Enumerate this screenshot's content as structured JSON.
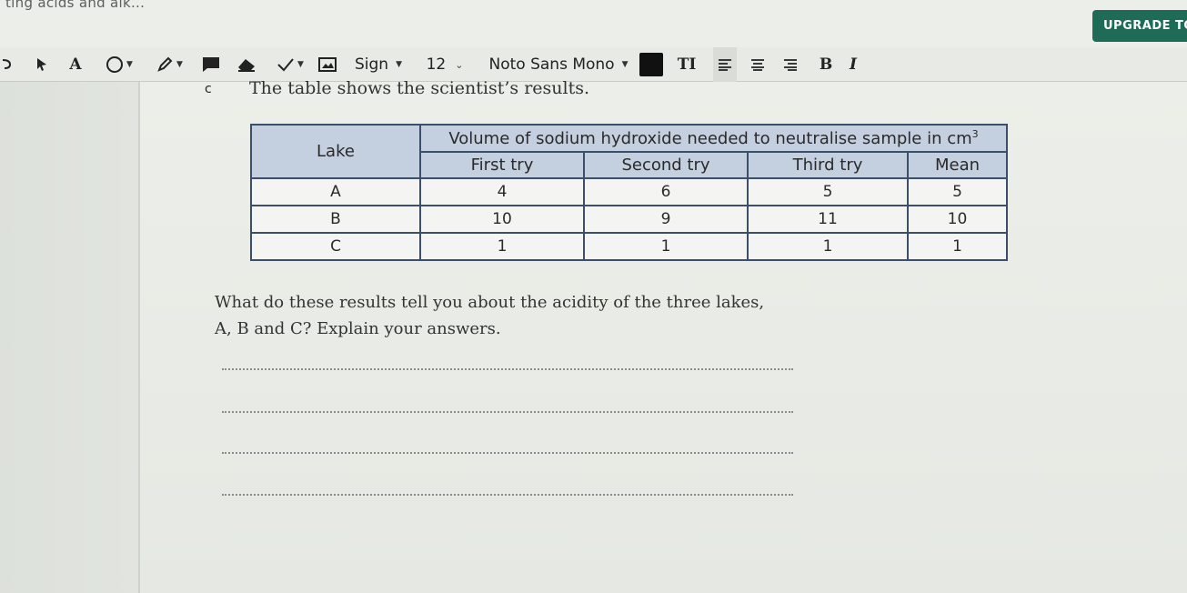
{
  "header": {
    "doc_title": "ting acids and alk...",
    "upgrade_label": "UPGRADE TO"
  },
  "toolbar": {
    "text_tool_label": "A",
    "sign_label": "Sign",
    "font_size": "12",
    "font_name": "Noto Sans Mono",
    "text_size_label": "TI",
    "bold_label": "B",
    "italic_label": "I",
    "color_value": "#111111"
  },
  "question": {
    "part_letter": "c",
    "intro": "The table shows the scientist’s results.",
    "prompt_line1": "What do these results tell you about the acidity of the three lakes,",
    "prompt_line2": "A, B and C? Explain your answers."
  },
  "table": {
    "lake_header": "Lake",
    "volume_header": "Volume of sodium hydroxide needed to neutralise sample in cm",
    "volume_unit_sup": "3",
    "sub_headers": [
      "First try",
      "Second try",
      "Third try",
      "Mean"
    ],
    "rows": [
      {
        "lake": "A",
        "first": "4",
        "second": "6",
        "third": "5",
        "mean": "5"
      },
      {
        "lake": "B",
        "first": "10",
        "second": "9",
        "third": "11",
        "mean": "10"
      },
      {
        "lake": "C",
        "first": "1",
        "second": "1",
        "third": "1",
        "mean": "1"
      }
    ]
  },
  "colors": {
    "accent": "#1e6b58",
    "table_header_bg": "#c4cfe0",
    "table_border": "#3b4e6b"
  }
}
